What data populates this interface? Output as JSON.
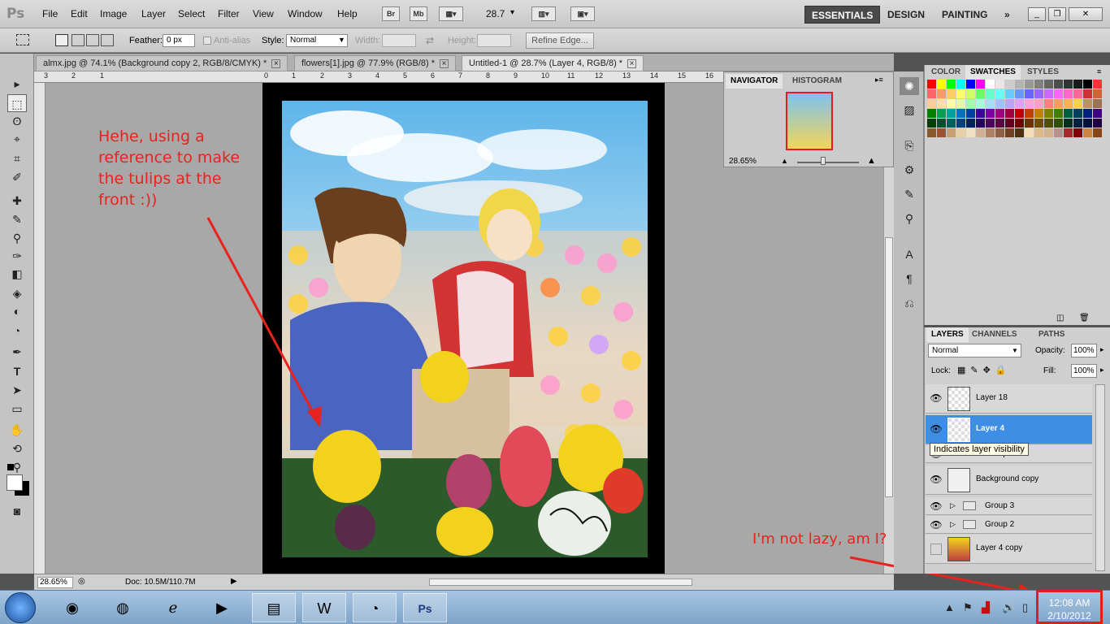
{
  "app": {
    "logo": "Ps"
  },
  "menu": [
    "File",
    "Edit",
    "Image",
    "Layer",
    "Select",
    "Filter",
    "View",
    "Window",
    "Help"
  ],
  "appbar": {
    "br": "Br",
    "mb": "Mb",
    "zoom": "28.7"
  },
  "workspaces": {
    "essentials": "ESSENTIALS",
    "design": "DESIGN",
    "painting": "PAINTING",
    "more": "»"
  },
  "window_buttons": {
    "minimize": "_",
    "restore": "❐",
    "close": "✕"
  },
  "options": {
    "feather_label": "Feather:",
    "feather_value": "0 px",
    "antialias_label": "Anti-alias",
    "style_label": "Style:",
    "style_value": "Normal",
    "width_label": "Width:",
    "height_label": "Height:",
    "refine_edge": "Refine Edge..."
  },
  "doc_tabs": [
    {
      "label": "almx.jpg @ 74.1% (Background copy 2, RGB/8/CMYK) *"
    },
    {
      "label": "flowers[1].jpg @ 77.9% (RGB/8) *"
    },
    {
      "label": "Untitled-1 @ 28.7% (Layer 4, RGB/8) *"
    }
  ],
  "ruler_numbers": [
    "3",
    "2",
    "1",
    "0",
    "1",
    "2",
    "3",
    "4",
    "5",
    "6",
    "7",
    "8",
    "9",
    "10",
    "11",
    "12",
    "13",
    "14",
    "15",
    "16"
  ],
  "tools": [
    "▸",
    "⬚",
    "ʘ",
    "⌖",
    "✂",
    "✎",
    "⌀",
    "✐",
    "▲",
    "◈",
    "⬤",
    "✦",
    "◐",
    "✑",
    "T",
    "▸",
    "▭",
    "✋",
    "🔍"
  ],
  "status": {
    "zoom": "28.65%",
    "doc": "Doc: 10.5M/110.7M"
  },
  "annotations": {
    "tulips": "Hehe, using a reference to make the tulips at the front :))",
    "lazy": "I'm not lazy, am I?"
  },
  "navigator": {
    "tab1": "NAVIGATOR",
    "tab2": "HISTOGRAM",
    "zoom": "28.65%"
  },
  "swatches_panel": {
    "tab_color": "COLOR",
    "tab_swatches": "SWATCHES",
    "tab_styles": "STYLES"
  },
  "layers_panel": {
    "tab_layers": "LAYERS",
    "tab_channels": "CHANNELS",
    "tab_paths": "PATHS",
    "blend_mode": "Normal",
    "opacity_label": "Opacity:",
    "opacity_value": "100%",
    "lock_label": "Lock:",
    "fill_label": "Fill:",
    "fill_value": "100%",
    "tooltip": "Indicates layer visibility",
    "layers": [
      {
        "name": "Layer 18",
        "visible": true,
        "selected": false,
        "type": "layer"
      },
      {
        "name": "Layer 4",
        "visible": true,
        "selected": true,
        "type": "layer"
      },
      {
        "name": "Group 5",
        "visible": true,
        "selected": false,
        "type": "group"
      },
      {
        "name": "Background copy",
        "visible": true,
        "selected": false,
        "type": "layer"
      },
      {
        "name": "Group 3",
        "visible": true,
        "selected": false,
        "type": "group"
      },
      {
        "name": "Group 2",
        "visible": true,
        "selected": false,
        "type": "group"
      },
      {
        "name": "Layer 4 copy",
        "visible": false,
        "selected": false,
        "type": "layer"
      }
    ]
  },
  "taskbar": {
    "apps": [
      "chrome-icon",
      "firefox-icon",
      "ie-icon",
      "media-player-icon",
      "explorer-icon",
      "word-icon",
      "app-icon",
      "photoshop-icon"
    ],
    "time": "12:08 AM",
    "date": "2/10/2012"
  },
  "colors": {
    "annotation": "#e8231d",
    "selection": "#3e8ee6",
    "panel": "#cfcfcf"
  }
}
